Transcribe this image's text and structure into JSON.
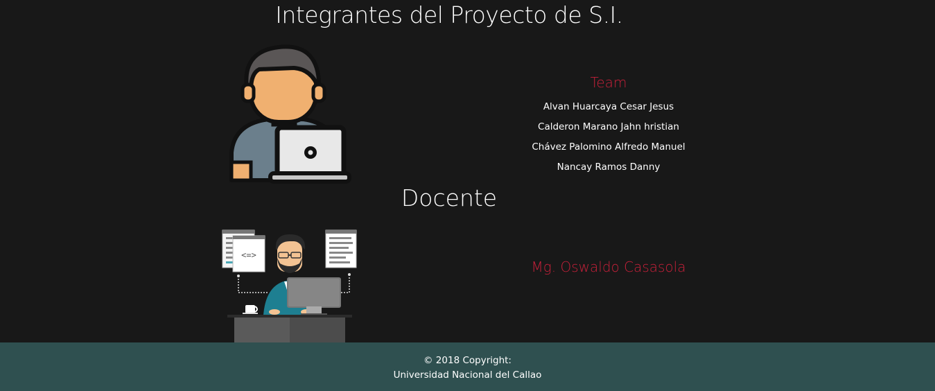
{
  "header": {
    "title": "Integrantes del Proyecto de S.I."
  },
  "team": {
    "heading": "Team",
    "members": [
      "Alvan Huarcaya Cesar Jesus",
      "Calderon Marano Jahn hristian",
      "Chávez Palomino Alfredo Manuel",
      "Nancay Ramos Danny"
    ],
    "illustration_icon": "developer-laptop-icon"
  },
  "docente": {
    "heading": "Docente",
    "name": "Mg. Oswaldo Casasola",
    "illustration_icon": "programmer-desk-icon"
  },
  "footer": {
    "copyright": "© 2018 Copyright:",
    "institution": "Universidad Nacional del Callao"
  },
  "colors": {
    "background": "#181818",
    "accent": "#c8203a",
    "footer": "#2f5050"
  }
}
